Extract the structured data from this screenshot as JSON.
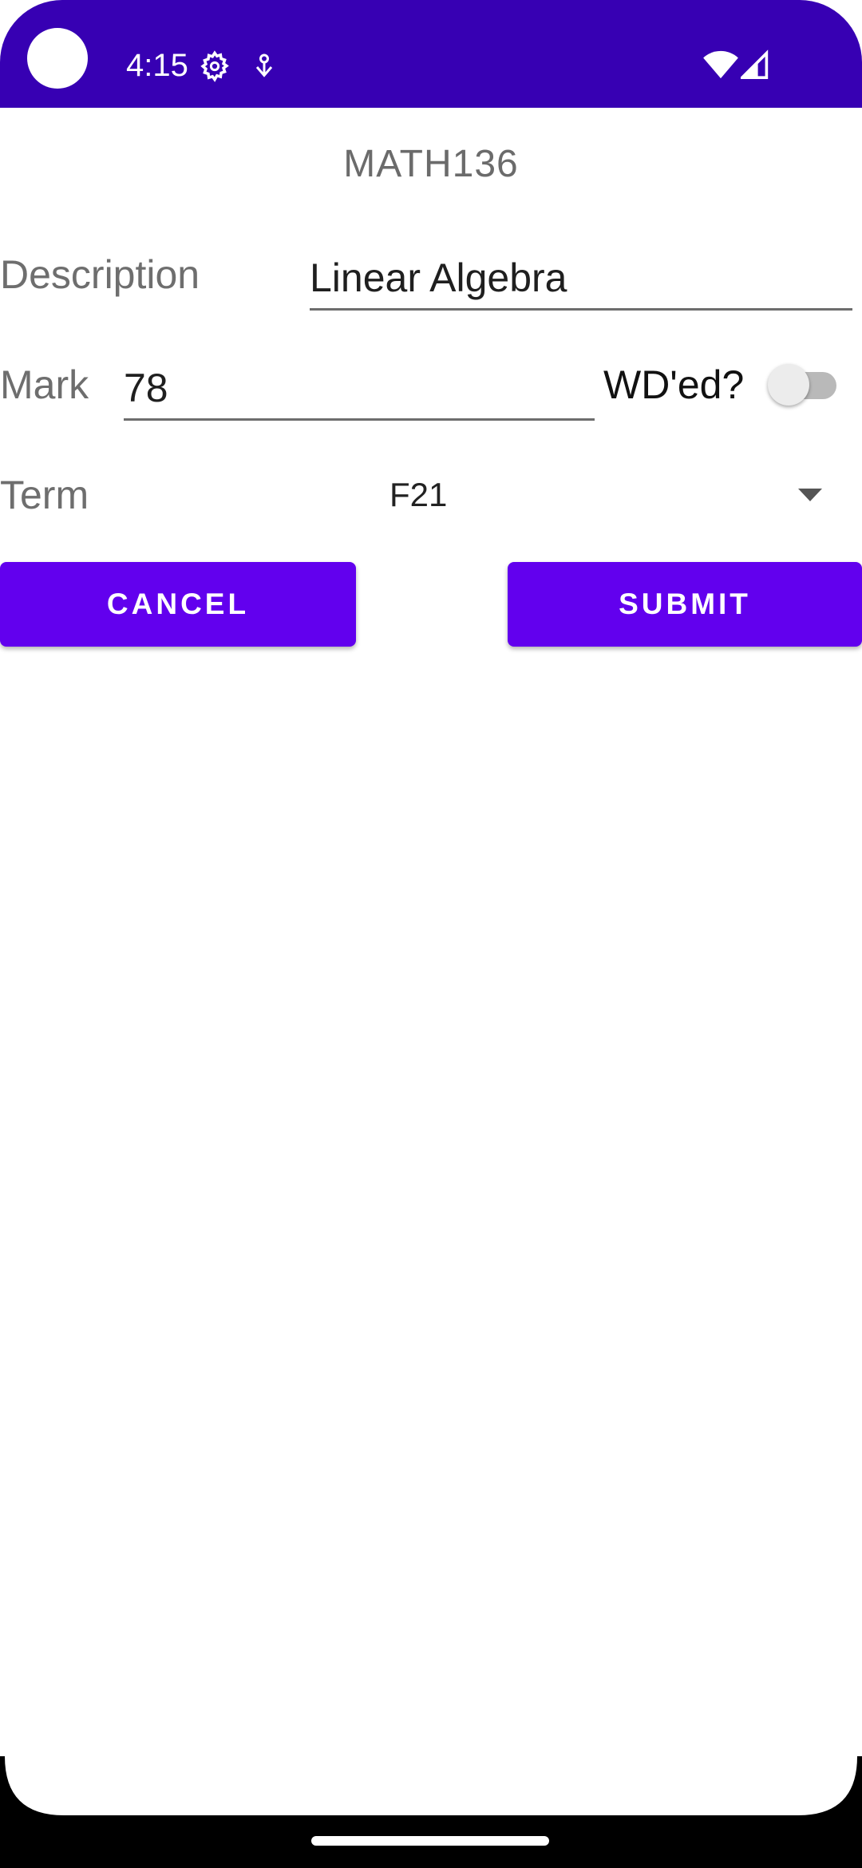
{
  "status_bar": {
    "time": "4:15",
    "background_color": "#3700b3",
    "icons": [
      "gear-icon",
      "notification-icon",
      "wifi-icon",
      "signal-icon"
    ]
  },
  "form": {
    "course_code": "MATH136",
    "description": {
      "label": "Description",
      "value": "Linear Algebra"
    },
    "mark": {
      "label": "Mark",
      "value": "78"
    },
    "withdrawn": {
      "label": "WD'ed?",
      "checked": false
    },
    "term": {
      "label": "Term",
      "selected": "F21"
    }
  },
  "buttons": {
    "cancel_label": "CANCEL",
    "submit_label": "SUBMIT",
    "color": "#6200ee"
  }
}
